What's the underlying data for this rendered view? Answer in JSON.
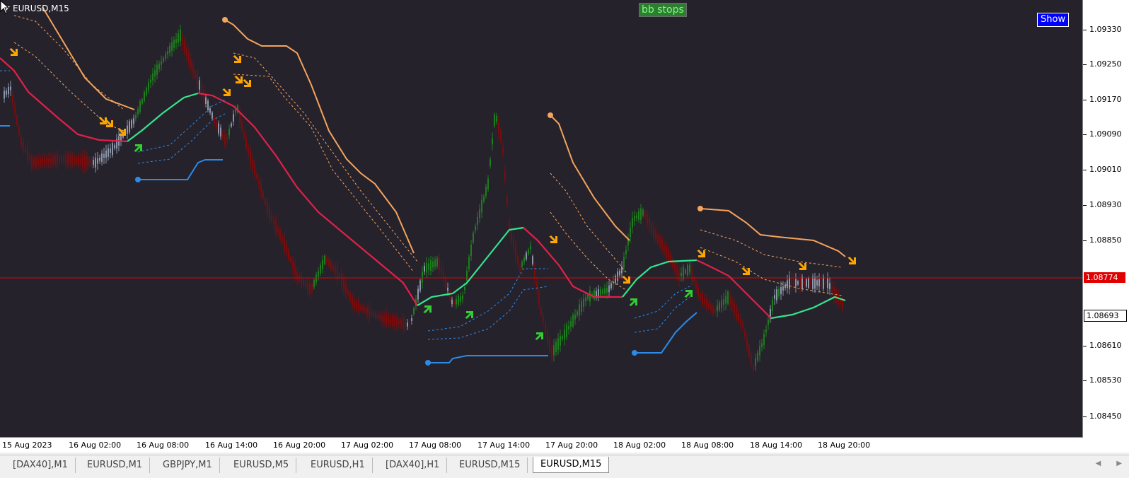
{
  "chart": {
    "symbol": "EURUSD,M15",
    "indicator_label": "bb stops",
    "show_button": "Show"
  },
  "price_axis": {
    "ticks": [
      "1.09330",
      "1.09250",
      "1.09170",
      "1.09090",
      "1.09010",
      "1.08930",
      "1.08850",
      "1.08774",
      "1.08693",
      "1.08610",
      "1.08530",
      "1.08450"
    ],
    "current_price": "1.08774",
    "last_price": "1.08693"
  },
  "time_axis": {
    "labels": [
      "15 Aug 2023",
      "16 Aug 02:00",
      "16 Aug 08:00",
      "16 Aug 14:00",
      "16 Aug 20:00",
      "17 Aug 02:00",
      "17 Aug 08:00",
      "17 Aug 14:00",
      "17 Aug 20:00",
      "18 Aug 02:00",
      "18 Aug 08:00",
      "18 Aug 14:00",
      "18 Aug 20:00"
    ]
  },
  "tabs": [
    {
      "label": "[DAX40],M1",
      "active": false
    },
    {
      "label": "EURUSD,M1",
      "active": false
    },
    {
      "label": "GBPJPY,M1",
      "active": false
    },
    {
      "label": "EURUSD,M5",
      "active": false
    },
    {
      "label": "EURUSD,H1",
      "active": false
    },
    {
      "label": "[DAX40],H1",
      "active": false
    },
    {
      "label": "EURUSD,M15",
      "active": false
    },
    {
      "label": "EURUSD,M15",
      "active": true
    }
  ],
  "colors": {
    "background": "#25222c",
    "bull_candle": "#1e7d1e",
    "bear_candle": "#7a0c0c",
    "neutral_candle": "#8c96a8",
    "middle_band_down": "#e0204a",
    "middle_band_up": "#33e68c",
    "upper_stop": "#f5a45c",
    "lower_stop": "#2b8be8",
    "arrow_down": "#ffa500",
    "arrow_up": "#33cc33",
    "current_price_line": "#e00000"
  }
}
